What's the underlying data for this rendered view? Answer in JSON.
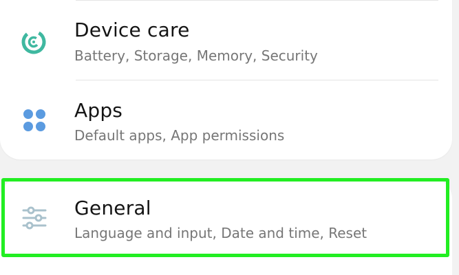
{
  "settings": {
    "items": [
      {
        "title": "Device care",
        "subtitle": "Battery, Storage, Memory, Security",
        "icon": "device-care-icon",
        "icon_color": "#3fb8a0"
      },
      {
        "title": "Apps",
        "subtitle": "Default apps, App permissions",
        "icon": "apps-icon",
        "icon_color": "#5b9be0"
      },
      {
        "title": "General",
        "subtitle": "Language and input, Date and time, Reset",
        "icon": "sliders-icon",
        "icon_color": "#a9c1cc"
      }
    ],
    "highlight_color": "#22ee22"
  }
}
